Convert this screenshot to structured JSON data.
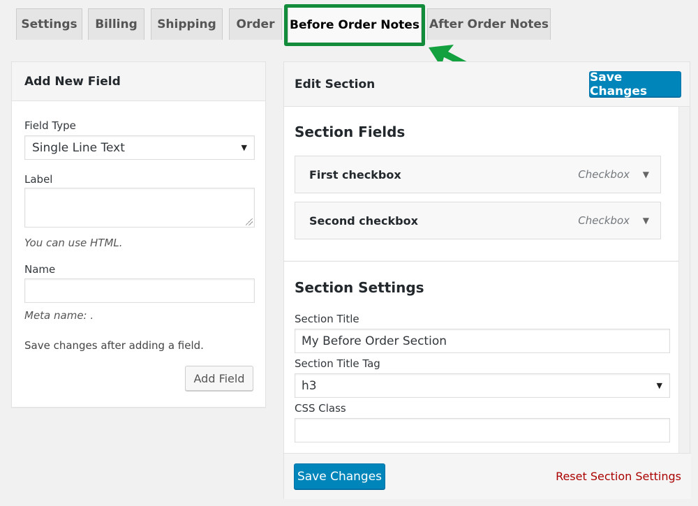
{
  "tabs": [
    {
      "label": "Settings",
      "active": false
    },
    {
      "label": "Billing",
      "active": false
    },
    {
      "label": "Shipping",
      "active": false
    },
    {
      "label": "Order",
      "active": false
    },
    {
      "label": "Before Order Notes",
      "active": true
    },
    {
      "label": "After Order Notes",
      "active": false
    }
  ],
  "annotation": {
    "highlight_color": "#128c3a",
    "arrow_color": "#13a03f",
    "arrow_icon": "arrow-pointing-to-tab"
  },
  "add_field": {
    "title": "Add New Field",
    "field_type_label": "Field Type",
    "field_type_value": "Single Line Text",
    "label_label": "Label",
    "label_value": "",
    "label_hint": "You can use HTML.",
    "name_label": "Name",
    "name_value": "",
    "meta_hint": "Meta name: .",
    "save_note": "Save changes after adding a field.",
    "add_button": "Add Field"
  },
  "edit_section": {
    "title": "Edit Section",
    "save_button": "Save Changes",
    "fields_heading": "Section Fields",
    "fields": [
      {
        "name": "First checkbox",
        "type": "Checkbox"
      },
      {
        "name": "Second checkbox",
        "type": "Checkbox"
      }
    ],
    "settings_heading": "Section Settings",
    "section_title_label": "Section Title",
    "section_title_value": "My Before Order Section",
    "title_tag_label": "Section Title Tag",
    "title_tag_value": "h3",
    "css_class_label": "CSS Class",
    "css_class_value": "",
    "footer_save_button": "Save Changes",
    "reset_link": "Reset Section Settings"
  },
  "colors": {
    "primary": "#0085ba",
    "danger_link": "#aa0000",
    "background": "#f1f1f1"
  }
}
